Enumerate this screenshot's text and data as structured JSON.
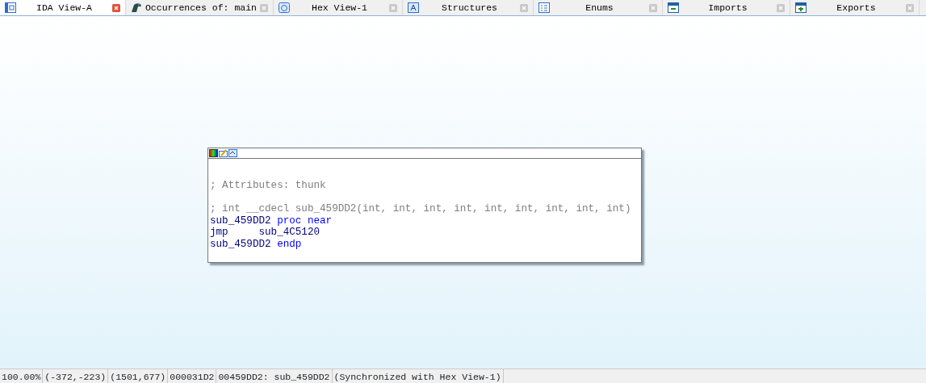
{
  "tabs": [
    {
      "label": "IDA View-A",
      "selected": true
    },
    {
      "label": "Occurrences of: main",
      "selected": false
    },
    {
      "label": "Hex View-1",
      "selected": false
    },
    {
      "label": "Structures",
      "selected": false
    },
    {
      "label": "Enums",
      "selected": false
    },
    {
      "label": "Imports",
      "selected": false
    },
    {
      "label": "Exports",
      "selected": false
    }
  ],
  "node": {
    "lines": [
      {
        "segments": [
          {
            "kind": "comment",
            "text": "; Attributes: thunk"
          }
        ]
      },
      {
        "blank_before": true,
        "segments": [
          {
            "kind": "comment",
            "text": "; int __cdecl sub_459DD2(int, int, int, int, int, int, int, int, int)"
          }
        ]
      },
      {
        "segments": [
          {
            "kind": "name",
            "text": "sub_459DD2"
          },
          {
            "kind": "keyword",
            "text": " proc near"
          }
        ]
      },
      {
        "segments": [
          {
            "kind": "name",
            "text": "jmp     sub_4C5120"
          }
        ]
      },
      {
        "segments": [
          {
            "kind": "name",
            "text": "sub_459DD2"
          },
          {
            "kind": "keyword",
            "text": " endp"
          }
        ]
      }
    ]
  },
  "status_bar": [
    "100.00%",
    "(-372,-223)",
    "(1501,677)",
    "000031D2",
    "00459DD2: sub_459DD2",
    "(Synchronized with Hex View-1)"
  ]
}
